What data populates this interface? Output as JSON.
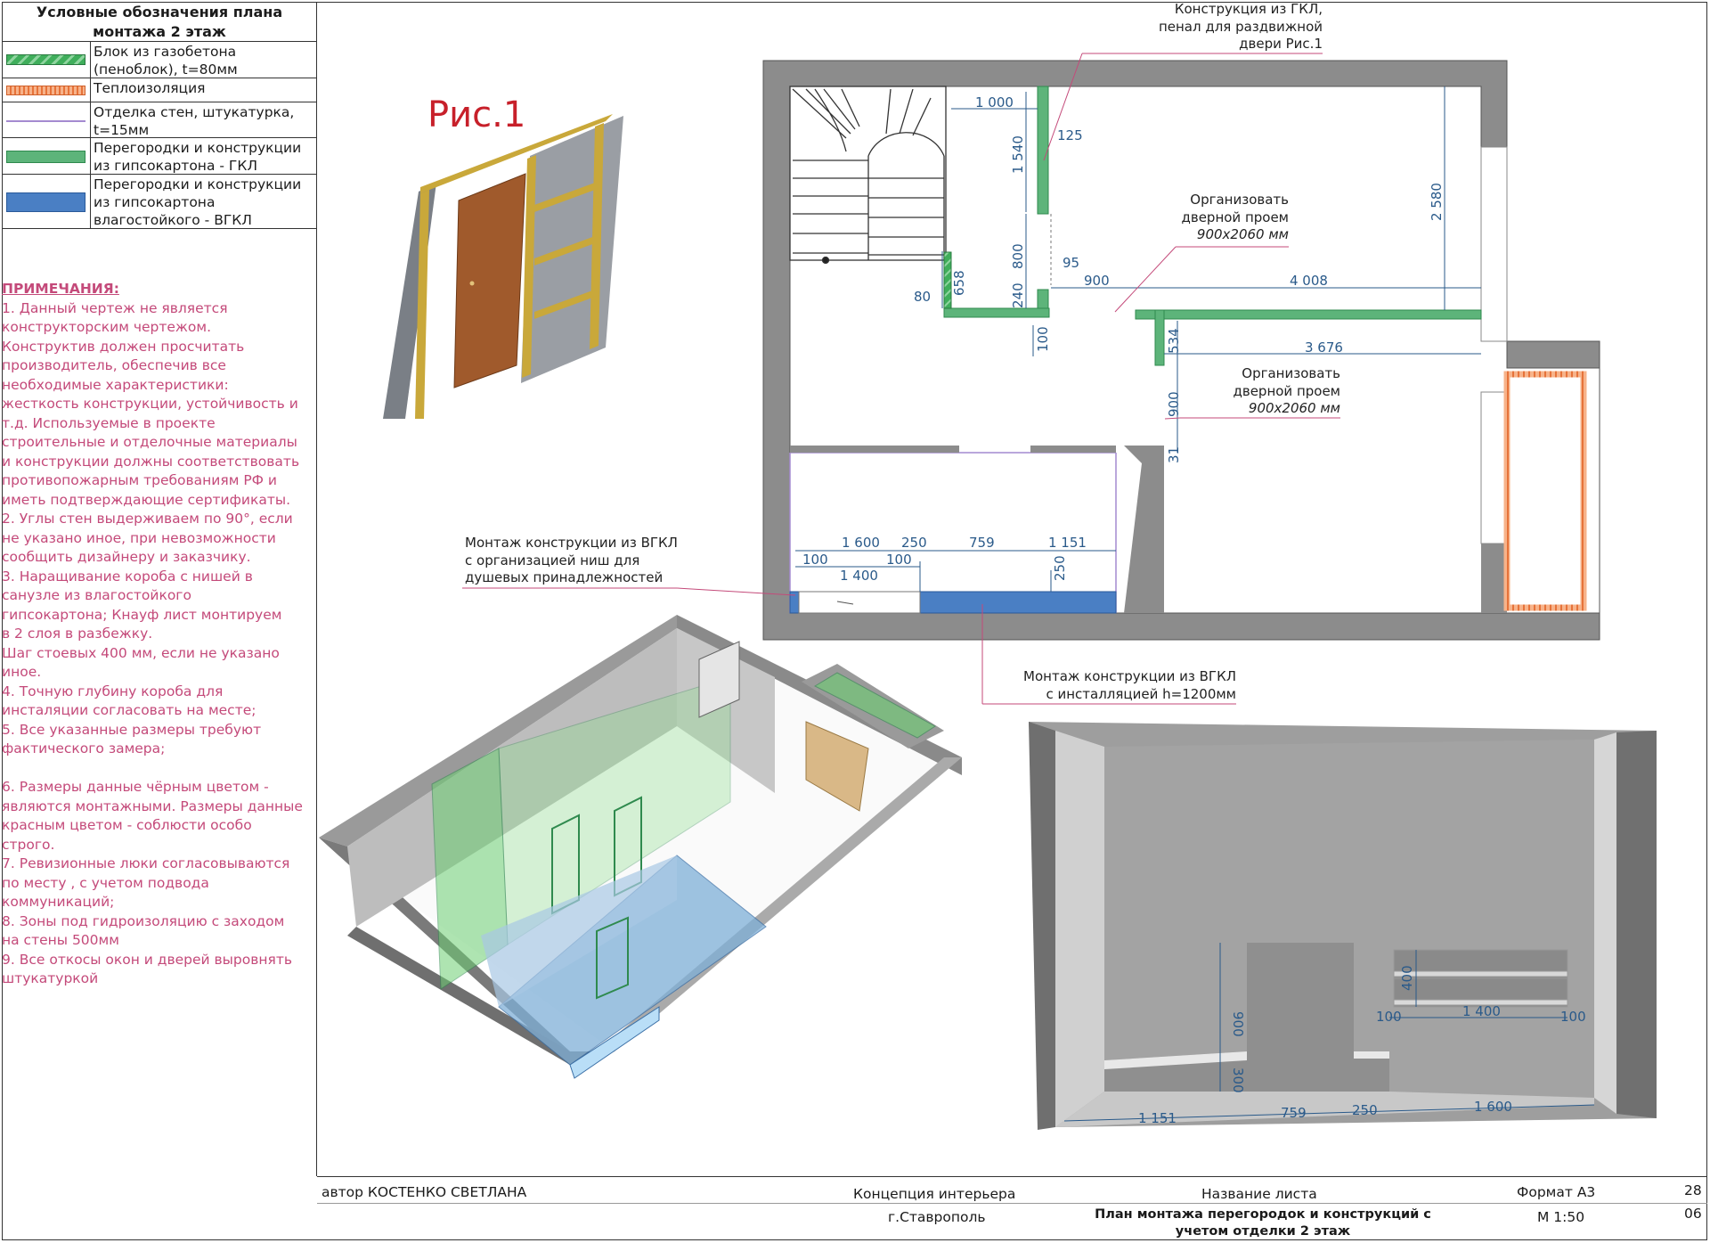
{
  "legend": {
    "title": "Условные обозначения плана монтажа 2 этаж",
    "items": [
      {
        "label": "Блок из газобетона (пеноблок), t=80мм",
        "color": "#3fae5b"
      },
      {
        "label": "Теплоизоляция",
        "color": "#f0925a"
      },
      {
        "label": "Отделка стен, штукатурка, t=15мм",
        "color": "#a48ad0"
      },
      {
        "label": "Перегородки и конструкции из гипсокартона - ГКЛ",
        "color": "#5db47a"
      },
      {
        "label": "Перегородки и конструкции из гипсокартона влагостойкого - ВГКЛ",
        "color": "#4a7fc4"
      }
    ]
  },
  "notes": {
    "heading": "ПРИМЕЧАНИЯ:",
    "lines": [
      "1. Данный чертеж не является",
      "конструкторским чертежом.",
      "Конструктив должен просчитать",
      "производитель, обеспечив все",
      "необходимые характеристики:",
      "жесткость конструкции, устойчивость и",
      "т.д. Используемые в проекте",
      "строительные и отделочные материалы",
      "и конструкции должны соответствовать",
      "противопожарным требованиям РФ и",
      "иметь подтверждающие сертификаты.",
      "2. Углы стен выдерживаем по 90°, если",
      "не указано иное, при невозможности",
      "сообщить дизайнеру и заказчику.",
      "3. Наращивание короба с нишей в",
      "санузле из влагостойкого",
      "гипсокартона; Кнауф лист монтируем",
      "в 2 слоя в разбежку.",
      "Шаг стоевых 400 мм, если не указано",
      "иное.",
      "4. Точную глубину короба для",
      "инсталяции согласовать на месте;",
      "5. Все указанные размеры требуют",
      "фактического замера;",
      "",
      "6. Размеры данные чёрным цветом -",
      "являются монтажными. Размеры данные",
      "красным цветом - соблюсти особо",
      "строго.",
      "7. Ревизионные люки согласовываются",
      "по месту , с учетом подвода",
      "коммуникаций;",
      "8. Зоны под гидроизоляцию с заходом",
      "на стены 500мм",
      "9. Все откосы окон и дверей выровнять",
      "штукатуркой"
    ]
  },
  "figure": {
    "label": "Рис.1"
  },
  "annotations": {
    "gkl_case": [
      "Конструкция из ГКЛ,",
      "пенал для раздвижной",
      "двери Рис.1"
    ],
    "door1": [
      "Организовать",
      "дверной проем",
      "900х2060 мм"
    ],
    "door2": [
      "Организовать",
      "дверной проем",
      "900х2060 мм"
    ],
    "vgkl_niches": [
      "Монтаж конструкции из ВГКЛ",
      "с организацией ниш для",
      "душевых принадлежностей"
    ],
    "vgkl_install": [
      "Монтаж конструкции из ВГКЛ",
      "с инсталляцией h=1200мм"
    ]
  },
  "plan_dims": {
    "d1000": "1 000",
    "d1540": "1 540",
    "d125": "125",
    "d2580": "2 580",
    "d800": "800",
    "d95": "95",
    "d80": "80",
    "d658": "658",
    "d240": "240",
    "d900a": "900",
    "d4008": "4 008",
    "d100a": "100",
    "d534": "534",
    "d3676": "3 676",
    "d900b": "900",
    "d31": "31",
    "d1600": "1 600",
    "d250a": "250",
    "d759": "759",
    "d1151": "1 151",
    "d100b": "100",
    "d100c": "100",
    "d1400": "1 400",
    "d250b": "250"
  },
  "elev_dims": {
    "d900": "900",
    "d300": "300",
    "d400": "400",
    "d100a": "100",
    "d1400": "1 400",
    "d100b": "100",
    "d1151": "1 151",
    "d759": "759",
    "d250": "250",
    "d1600": "1 600"
  },
  "titleblock": {
    "author": "автор КОСТЕНКО СВЕТЛАНА",
    "project": "Концепция интерьера",
    "city": "г.Ставрополь",
    "sheet_name_label": "Название листа",
    "sheet_name": [
      "План монтажа перегородок и конструкций с",
      "учетом отделки 2 этаж"
    ],
    "format": "Формат А3",
    "scale": "М 1:50",
    "page": "28",
    "sheet": "06"
  }
}
